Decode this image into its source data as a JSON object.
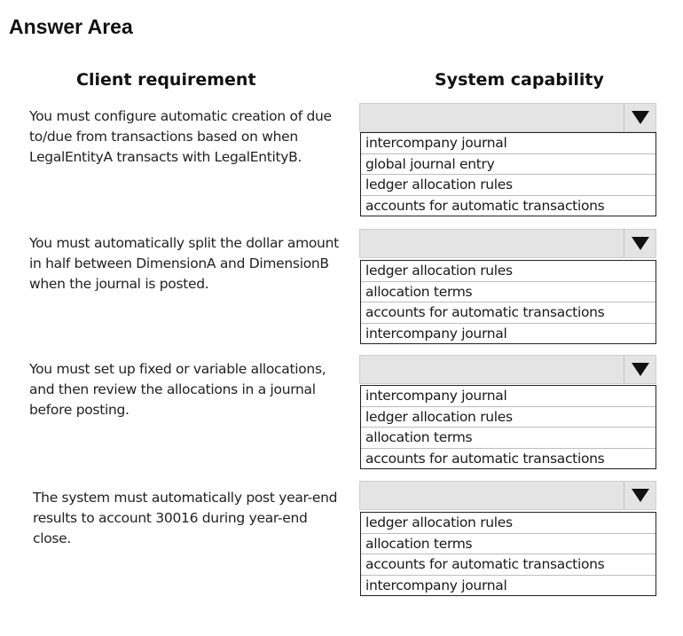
{
  "title": "Answer Area",
  "headers": {
    "left": "Client requirement",
    "right": "System capability"
  },
  "rows": [
    {
      "requirement": [
        "You must configure automatic creation of due",
        "to/due from transactions based on when",
        "LegalEntityA transacts with LegalEntityB."
      ],
      "selected": "",
      "options": [
        "intercompany journal",
        "global journal entry",
        "ledger allocation rules",
        "accounts for automatic transactions"
      ]
    },
    {
      "requirement": [
        "You must automatically split the dollar amount",
        "in half between DimensionA and DimensionB",
        "when the journal is posted."
      ],
      "selected": "",
      "options": [
        "ledger allocation rules",
        "allocation terms",
        "accounts for automatic transactions",
        "intercompany journal"
      ]
    },
    {
      "requirement": [
        "You must set up fixed or variable allocations,",
        "and then review the allocations in a journal",
        "before posting."
      ],
      "selected": "",
      "options": [
        "intercompany journal",
        "ledger allocation rules",
        "allocation terms",
        "accounts for automatic transactions"
      ]
    },
    {
      "requirement": [
        "The system must automatically post year-end",
        "results to account 30016 during year-end",
        "close."
      ],
      "selected": "",
      "options": [
        "ledger allocation rules",
        "allocation terms",
        "accounts for automatic transactions",
        "intercompany journal"
      ]
    }
  ]
}
